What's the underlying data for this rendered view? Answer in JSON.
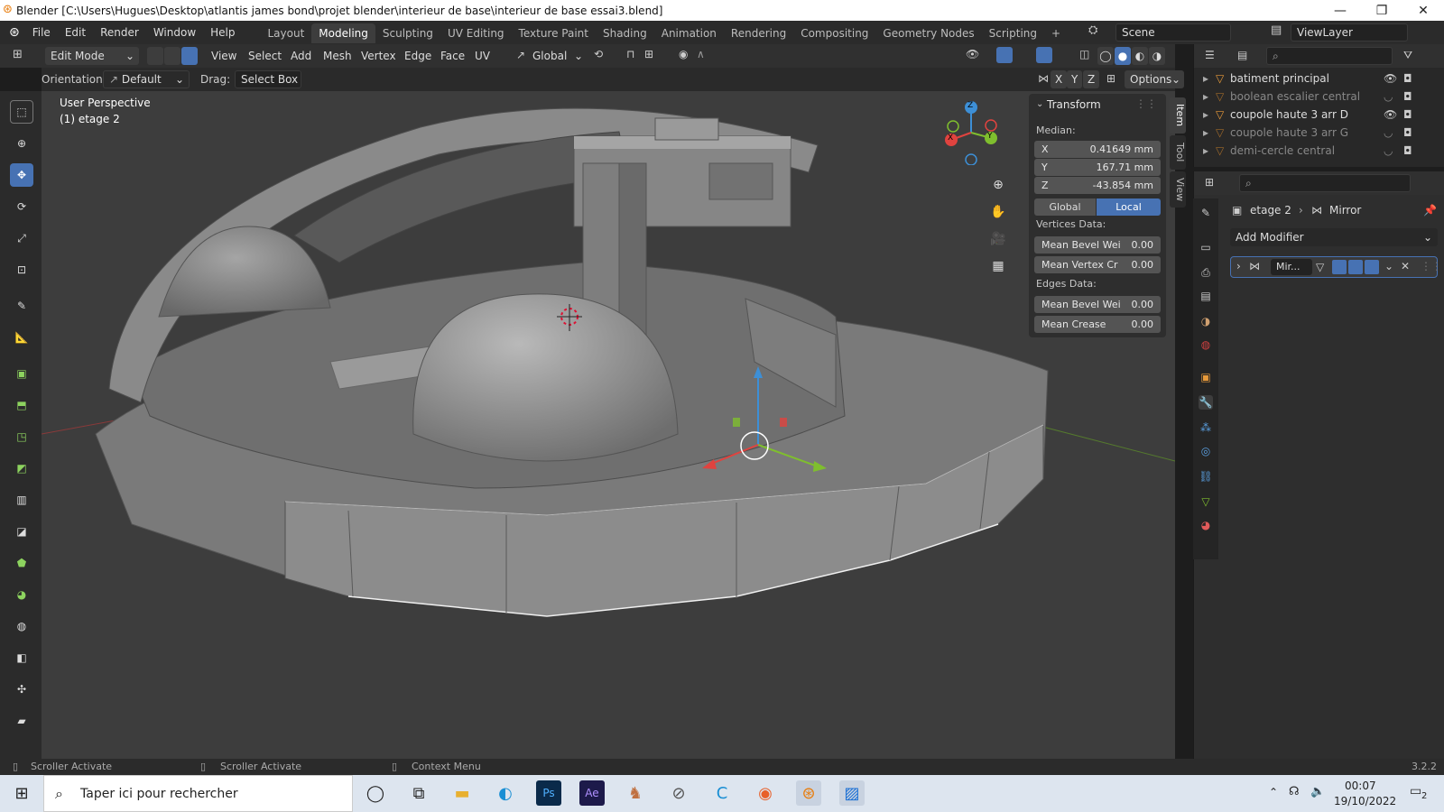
{
  "window": {
    "title": "Blender [C:\\Users\\Hugues\\Desktop\\atlantis james bond\\projet blender\\interieur de base\\interieur de base essai3.blend]",
    "minimize": "—",
    "maximize": "❐",
    "close": "✕"
  },
  "menu": [
    "File",
    "Edit",
    "Render",
    "Window",
    "Help"
  ],
  "workspaces": {
    "tabs": [
      "Layout",
      "Modeling",
      "Sculpting",
      "UV Editing",
      "Texture Paint",
      "Shading",
      "Animation",
      "Rendering",
      "Compositing",
      "Geometry Nodes",
      "Scripting"
    ],
    "active": "Modeling",
    "add": "+"
  },
  "scene": {
    "name": "Scene",
    "view_layer": "ViewLayer"
  },
  "viewport_header": {
    "mode": "Edit Mode",
    "menus": [
      "View",
      "Select",
      "Add",
      "Mesh",
      "Vertex",
      "Edge",
      "Face",
      "UV"
    ],
    "transform_orientation": "Global"
  },
  "tool_settings": {
    "orientation_label": "Orientation:",
    "orientation_value": "Default",
    "drag_label": "Drag:",
    "drag_value": "Select Box",
    "axes": [
      "X",
      "Y",
      "Z"
    ],
    "options": "Options"
  },
  "viewport": {
    "view_name": "User Perspective",
    "object_info": "(1) etage 2",
    "gizmo_axes": [
      "Z",
      "Y",
      "X"
    ]
  },
  "n_panel": {
    "section": "Transform",
    "median_label": "Median:",
    "median": [
      {
        "axis": "X",
        "value": "0.41649 mm"
      },
      {
        "axis": "Y",
        "value": "167.71 mm"
      },
      {
        "axis": "Z",
        "value": "-43.854 mm"
      }
    ],
    "space_global": "Global",
    "space_local": "Local",
    "vertices_label": "Vertices Data:",
    "vertices": [
      {
        "key": "Mean Bevel Wei",
        "value": "0.00"
      },
      {
        "key": "Mean Vertex Cr",
        "value": "0.00"
      }
    ],
    "edges_label": "Edges Data:",
    "edges": [
      {
        "key": "Mean Bevel Wei",
        "value": "0.00"
      },
      {
        "key": "Mean Crease",
        "value": "0.00"
      }
    ],
    "tabs": [
      "Item",
      "Tool",
      "View"
    ]
  },
  "outliner": {
    "items": [
      {
        "name": "batiment principal",
        "dim": false
      },
      {
        "name": "boolean escalier central",
        "dim": true
      },
      {
        "name": "coupole haute 3 arr D",
        "dim": false
      },
      {
        "name": "coupole haute 3 arr G",
        "dim": true
      },
      {
        "name": "demi-cercle central",
        "dim": true
      }
    ]
  },
  "properties": {
    "breadcrumb_object": "etage 2",
    "breadcrumb_modifier": "Mirror",
    "add_modifier": "Add Modifier",
    "modifier_name": "Mir..."
  },
  "statusbar": {
    "left": "Scroller Activate",
    "middle": "Scroller Activate",
    "right": "Context Menu",
    "version": "3.2.2"
  },
  "taskbar": {
    "search_placeholder": "Taper ici pour rechercher",
    "time": "00:07",
    "date": "19/10/2022",
    "notifications": "2"
  },
  "colors": {
    "accent": "#4772b3",
    "axis_x": "#e0433f",
    "axis_y": "#7fbe2e",
    "axis_z": "#3d8fd6"
  }
}
